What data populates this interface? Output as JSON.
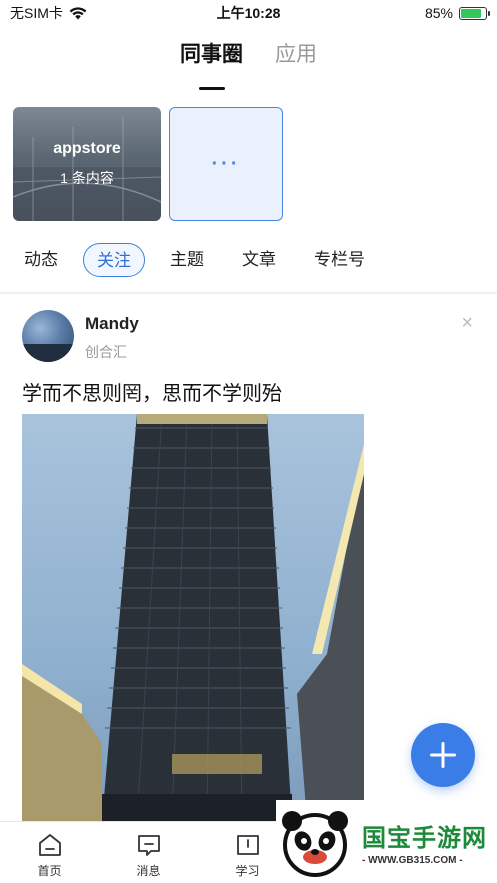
{
  "status_bar": {
    "carrier": "无SIM卡",
    "time": "上午10:28",
    "battery_percent": "85%",
    "battery_level": 0.85
  },
  "top_tabs": [
    {
      "label": "同事圈",
      "active": true
    },
    {
      "label": "应用",
      "active": false
    }
  ],
  "cards": {
    "app_card": {
      "title": "appstore",
      "subtitle": "1 条内容"
    },
    "more_card": {
      "label": "···"
    }
  },
  "sub_tabs": [
    {
      "label": "动态",
      "active": false
    },
    {
      "label": "关注",
      "active": true
    },
    {
      "label": "主题",
      "active": false
    },
    {
      "label": "文章",
      "active": false
    },
    {
      "label": "专栏号",
      "active": false
    }
  ],
  "post": {
    "author": "Mandy",
    "org": "创合汇",
    "text": "学而不思则罔，思而不学则殆",
    "close_glyph": "×"
  },
  "bottom_nav": [
    {
      "label": "首页",
      "icon": "home-icon"
    },
    {
      "label": "消息",
      "icon": "message-icon"
    },
    {
      "label": "学习",
      "icon": "book-icon"
    }
  ],
  "fab": {
    "icon": "plus-icon"
  },
  "watermark": {
    "title": "国宝手游网",
    "url": "- WWW.GB315.COM -"
  },
  "colors": {
    "accent": "#3b7de6",
    "active_tab_text": "#2f6fd6",
    "watermark_green": "#1d8a3a"
  }
}
